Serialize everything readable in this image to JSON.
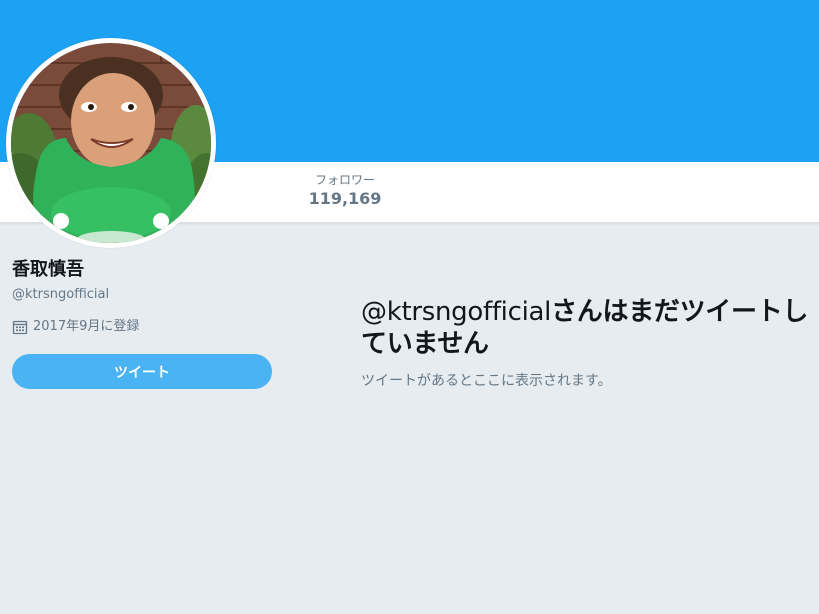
{
  "colors": {
    "banner": "#1da1f2",
    "accent": "#4ab3f4",
    "page_bg": "#e6ecf0",
    "muted_text": "#657786"
  },
  "nav": {
    "followers_label": "フォロワー",
    "followers_count": "119,169"
  },
  "profile": {
    "name": "香取慎吾",
    "handle": "@ktrsngofficial",
    "joined": "2017年9月に登録",
    "joined_icon": "calendar-icon",
    "avatar_icon": "profile-photo"
  },
  "tweet_button": {
    "label": "ツイート"
  },
  "empty_state": {
    "title_handle": "@ktrsngofficial",
    "title_rest": "さんはまだツイートしていません",
    "subtitle": "ツイートがあるとここに表示されます。"
  }
}
